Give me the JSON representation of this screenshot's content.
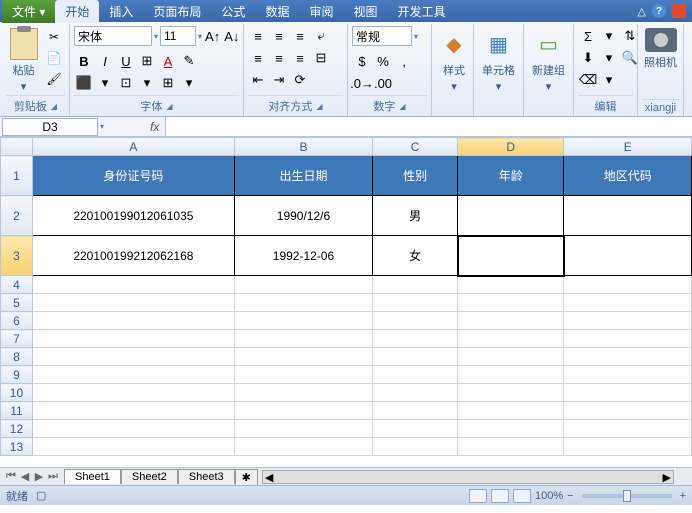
{
  "tabs": {
    "file": "文件",
    "home": "开始",
    "insert": "插入",
    "page": "页面布局",
    "formula": "公式",
    "data": "数据",
    "review": "审阅",
    "view": "视图",
    "dev": "开发工具"
  },
  "groups": {
    "clipboard": "剪贴板",
    "font": "字体",
    "align": "对齐方式",
    "number": "数字",
    "style": "样式",
    "cellfmt": "单元格",
    "newgroup": "新建组",
    "edit": "编辑",
    "camera": "xiangji"
  },
  "ribbon": {
    "paste": "粘贴",
    "style": "样式",
    "cellfmt": "单元格",
    "newgroup": "新建组",
    "camera": "照相机"
  },
  "font": {
    "name": "宋体",
    "size": "11",
    "general": "常规"
  },
  "namebox": "D3",
  "cols": [
    "A",
    "B",
    "C",
    "D",
    "E"
  ],
  "headers": {
    "id": "身份证号码",
    "dob": "出生日期",
    "sex": "性别",
    "age": "年龄",
    "region": "地区代码"
  },
  "rows": [
    {
      "id": "220100199012061035",
      "dob": "1990/12/6",
      "sex": "男",
      "age": "",
      "region": ""
    },
    {
      "id": "220100199212062168",
      "dob": "1992-12-06",
      "sex": "女",
      "age": "",
      "region": ""
    }
  ],
  "sheets": [
    "Sheet1",
    "Sheet2",
    "Sheet3"
  ],
  "status": {
    "ready": "就绪",
    "rec": "",
    "zoom": "100%",
    "minus": "−",
    "plus": "+"
  }
}
